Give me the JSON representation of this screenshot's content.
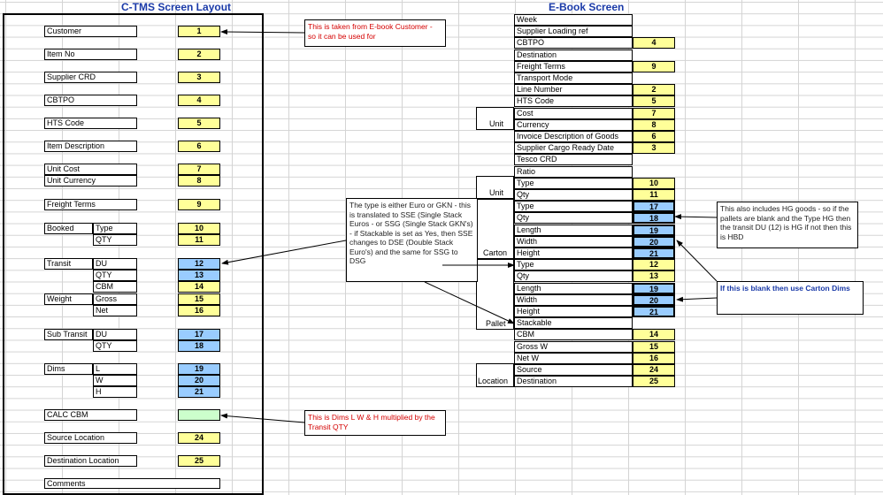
{
  "ctms": {
    "title": "C-TMS Screen Layout",
    "fields": {
      "customer": "Customer",
      "customer_n": "1",
      "item_no": "Item No",
      "item_no_n": "2",
      "supplier_crd": "Supplier CRD",
      "supplier_crd_n": "3",
      "cbtpo": "CBTPO",
      "cbtpo_n": "4",
      "hts_code": "HTS Code",
      "hts_code_n": "5",
      "item_description": "Item Description",
      "item_description_n": "6",
      "unit_cost": "Unit Cost",
      "unit_cost_n": "7",
      "unit_currency": "Unit Currency",
      "unit_currency_n": "8",
      "freight_terms": "Freight Terms",
      "freight_terms_n": "9",
      "booked": "Booked",
      "booked_type": "Type",
      "booked_type_n": "10",
      "booked_qty": "QTY",
      "booked_qty_n": "11",
      "transit": "Transit",
      "transit_du": "DU",
      "transit_du_n": "12",
      "transit_qty": "QTY",
      "transit_qty_n": "13",
      "transit_cbm": "CBM",
      "transit_cbm_n": "14",
      "weight": "Weight",
      "weight_gross": "Gross",
      "weight_gross_n": "15",
      "weight_net": "Net",
      "weight_net_n": "16",
      "sub_transit": "Sub Transit",
      "sub_transit_du": "DU",
      "sub_transit_du_n": "17",
      "sub_transit_qty": "QTY",
      "sub_transit_qty_n": "18",
      "dims": "Dims",
      "dims_l": "L",
      "dims_l_n": "19",
      "dims_w": "W",
      "dims_w_n": "20",
      "dims_h": "H",
      "dims_h_n": "21",
      "calc_cbm": "CALC CBM",
      "source_location": "Source Location",
      "source_location_n": "24",
      "destination_location": "Destination Location",
      "destination_location_n": "25",
      "comments": "Comments"
    }
  },
  "ebook": {
    "title": "E-Book Screen",
    "groups": {
      "unit1": "Unit",
      "unit2": "Unit",
      "carton": "Carton",
      "pallet": "Pallet",
      "location": "Location"
    },
    "rows": [
      {
        "label": "Week",
        "value": ""
      },
      {
        "label": "Supplier Loading ref",
        "value": ""
      },
      {
        "label": "CBTPO",
        "value": "4"
      },
      {
        "label": "Destination",
        "value": ""
      },
      {
        "label": "Freight Terms",
        "value": "9"
      },
      {
        "label": "Transport Mode",
        "value": ""
      },
      {
        "label": "Line Number",
        "value": "2"
      },
      {
        "label": "HTS Code",
        "value": "5"
      },
      {
        "label": "Cost",
        "value": "7"
      },
      {
        "label": "Currency",
        "value": "8"
      },
      {
        "label": "Invoice Description of Goods",
        "value": "6"
      },
      {
        "label": "Supplier Cargo Ready Date",
        "value": "3"
      },
      {
        "label": "Tesco CRD",
        "value": ""
      },
      {
        "label": "Ratio",
        "value": ""
      },
      {
        "label": "Type",
        "value": "10"
      },
      {
        "label": "Qty",
        "value": "11"
      },
      {
        "label": "Type",
        "value": "17"
      },
      {
        "label": "Qty",
        "value": "18"
      },
      {
        "label": "Length",
        "value": "19"
      },
      {
        "label": "Width",
        "value": "20"
      },
      {
        "label": "Height",
        "value": "21"
      },
      {
        "label": "Type",
        "value": "12"
      },
      {
        "label": "Qty",
        "value": "13"
      },
      {
        "label": "Length",
        "value": "19"
      },
      {
        "label": "Width",
        "value": "20"
      },
      {
        "label": "Height",
        "value": "21"
      },
      {
        "label": "Stackable",
        "value": ""
      },
      {
        "label": "CBM",
        "value": "14"
      },
      {
        "label": "Gross W",
        "value": "15"
      },
      {
        "label": "Net W",
        "value": "16"
      },
      {
        "label": "Source",
        "value": "24"
      },
      {
        "label": "Destination",
        "value": "25"
      }
    ]
  },
  "notes": {
    "customer": "This is taken from E-book Customer - so it can be used for",
    "type": "The type is either Euro or GKN - this is translated to SSE (Single Stack Euros - or SSG (Single Stack GKN's) - if Stackable is set as Yes, then SSE changes to DSE (Double Stack Euro's) and the same for SSG to DSG",
    "hg": "This also includes HG goods - so if the pallets are blank and the Type HG then the transit DU (12) is HG if not then this is HBD",
    "carton": "If this is blank then use Carton Dims",
    "calc": "This is Dims L W & H multiplied by the Transit QTY"
  },
  "colors": {
    "yellow": "#ffff99",
    "blue": "#99ccff",
    "green": "#ccffcc",
    "title": "#1a3aa8",
    "note_red": "#d40000"
  }
}
